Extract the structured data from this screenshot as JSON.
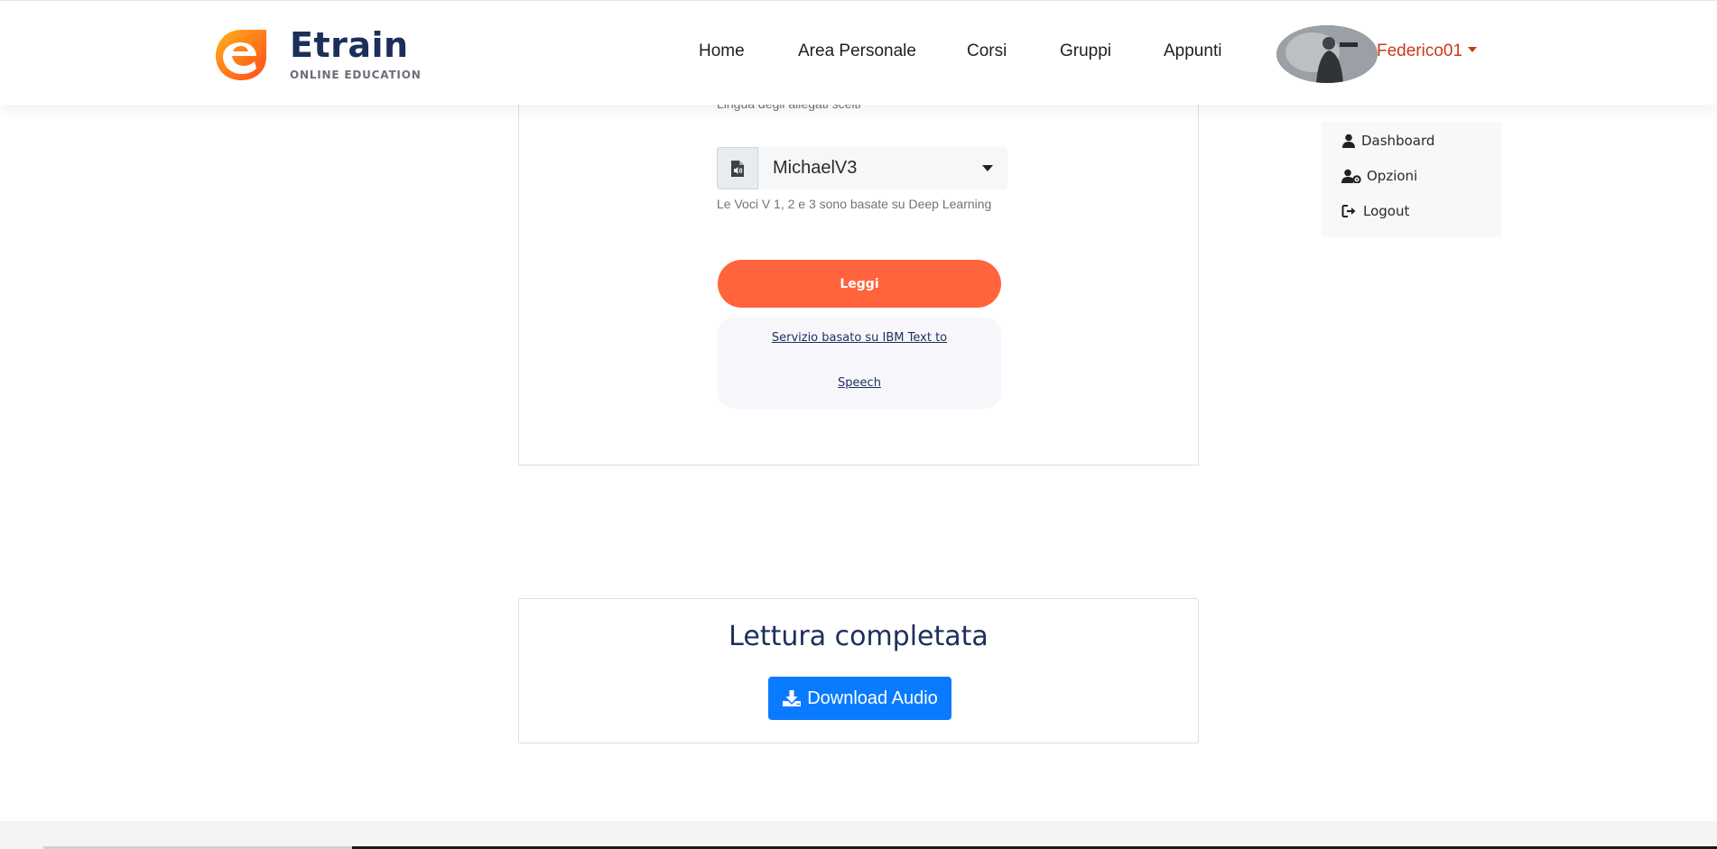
{
  "brand": {
    "name": "Etrain",
    "tagline": "ONLINE EDUCATION"
  },
  "nav": {
    "items": [
      {
        "label": "Home"
      },
      {
        "label": "Area Personale"
      },
      {
        "label": "Corsi"
      },
      {
        "label": "Gruppi"
      },
      {
        "label": "Appunti"
      }
    ],
    "user": "Federico01"
  },
  "user_menu": {
    "items": [
      {
        "label": "Dashboard",
        "icon": "user-icon"
      },
      {
        "label": "Opzioni",
        "icon": "user-cog-icon"
      },
      {
        "label": "Logout",
        "icon": "sign-out-icon"
      }
    ]
  },
  "reader": {
    "language_hint": "Lingua degli allegati scelti",
    "voice_icon": "file-audio-icon",
    "voice_selected": "MichaelV3",
    "voice_hint": "Le Voci V 1, 2 e 3 sono basate su Deep Learning",
    "read_button": "Leggi",
    "service_line1": "Servizio basato su IBM Text to",
    "service_line2": "Speech"
  },
  "result": {
    "title": "Lettura completata",
    "download_button": "Download Audio",
    "download_icon": "download-icon"
  },
  "colors": {
    "accent": "#ff643d",
    "primary": "#0a7bff",
    "brand_navy": "#1b2f5a",
    "user_link": "#c83a17"
  }
}
